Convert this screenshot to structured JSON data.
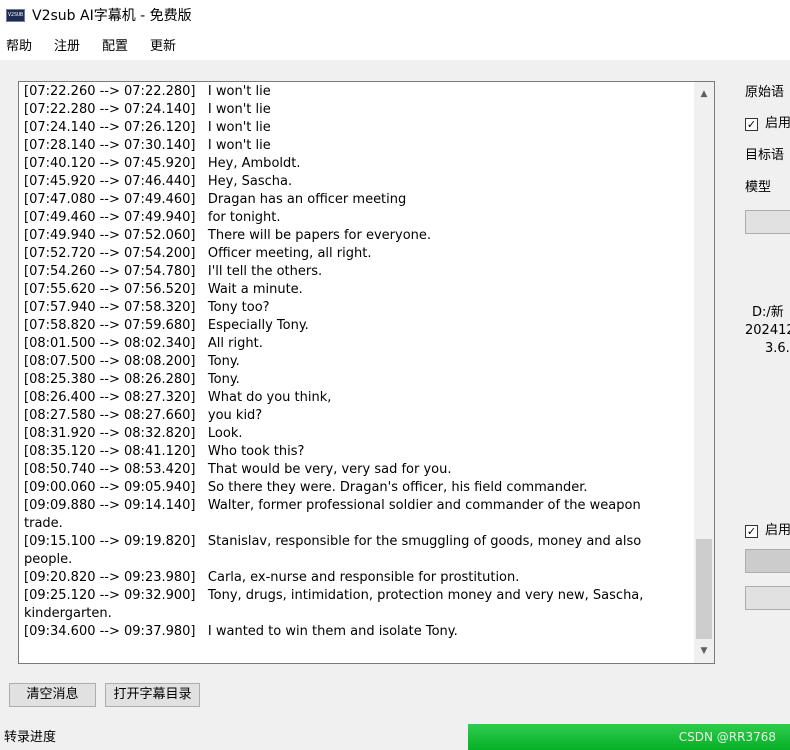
{
  "window": {
    "title": "V2sub AI字幕机 - 免费版",
    "icon_text": "V2SUB",
    "icon_name": "app-logo-icon"
  },
  "menu": {
    "items": [
      "帮助",
      "注册",
      "配置",
      "更新"
    ]
  },
  "log": {
    "lines": [
      "[07:22.260 --> 07:22.280]   I won't lie",
      "[07:22.280 --> 07:24.140]   I won't lie",
      "[07:24.140 --> 07:26.120]   I won't lie",
      "[07:28.140 --> 07:30.140]   I won't lie",
      "[07:40.120 --> 07:45.920]   Hey, Amboldt.",
      "[07:45.920 --> 07:46.440]   Hey, Sascha.",
      "[07:47.080 --> 07:49.460]   Dragan has an officer meeting",
      "[07:49.460 --> 07:49.940]   for tonight.",
      "[07:49.940 --> 07:52.060]   There will be papers for everyone.",
      "[07:52.720 --> 07:54.200]   Officer meeting, all right.",
      "[07:54.260 --> 07:54.780]   I'll tell the others.",
      "[07:55.620 --> 07:56.520]   Wait a minute.",
      "[07:57.940 --> 07:58.320]   Tony too?",
      "[07:58.820 --> 07:59.680]   Especially Tony.",
      "[08:01.500 --> 08:02.340]   All right.",
      "[08:07.500 --> 08:08.200]   Tony.",
      "[08:25.380 --> 08:26.280]   Tony.",
      "[08:26.400 --> 08:27.320]   What do you think,",
      "[08:27.580 --> 08:27.660]   you kid?",
      "[08:31.920 --> 08:32.820]   Look.",
      "[08:35.120 --> 08:41.120]   Who took this?",
      "[08:50.740 --> 08:53.420]   That would be very, very sad for you.",
      "[09:00.060 --> 09:05.940]   So there they were. Dragan's officer, his field commander.",
      "[09:09.880 --> 09:14.140]   Walter, former professional soldier and commander of the weapon\ntrade.",
      "[09:15.100 --> 09:19.820]   Stanislav, responsible for the smuggling of goods, money and also\npeople.",
      "[09:20.820 --> 09:23.980]   Carla, ex-nurse and responsible for prostitution.",
      "[09:25.120 --> 09:32.900]   Tony, drugs, intimidation, protection money and very new, Sascha,\nkindergarten.",
      "[09:34.600 --> 09:37.980]   I wanted to win them and isolate Tony."
    ],
    "scroll_up_icon": "chevron-up-icon",
    "scroll_down_icon": "chevron-down-icon",
    "scroll_position": 0.9
  },
  "buttons": {
    "clear_label": "清空消息",
    "open_dir_label": "打开字幕目录"
  },
  "progress": {
    "label": "转录进度",
    "value": 1.0,
    "color": "#06b025",
    "watermark": "CSDN @RR3768"
  },
  "side_panel": {
    "source_lang_label": "原始语",
    "enable_label_1": "启用",
    "target_lang_label": "目标语",
    "model_label": "模型",
    "info_line_1": "D:/新",
    "info_line_2": "202412",
    "info_line_3": "3.6.",
    "enable_label_2": "启用",
    "check_mark": "✓"
  },
  "colors": {
    "content_bg": "#f0f0f0",
    "progress_green": "#06b025",
    "button_bg": "#e1e1e1"
  }
}
